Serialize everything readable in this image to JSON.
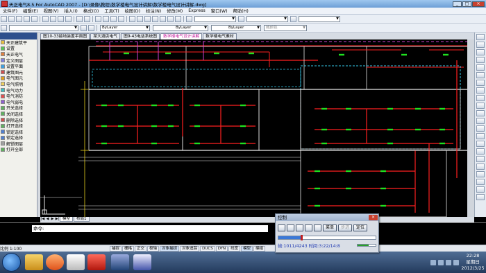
{
  "window": {
    "title": "天正电气8.5 For AutoCAD 2007 - [D:\\录像\\教程\\数学楼电气设计讲解\\数学楼电气设计讲解.dwg]",
    "buttons": [
      "_",
      "□",
      "×"
    ]
  },
  "menu": [
    "文件(F)",
    "编辑(E)",
    "视图(V)",
    "插入(I)",
    "格式(O)",
    "工具(T)",
    "绘图(D)",
    "标注(N)",
    "修改(M)",
    "Express",
    "窗口(W)",
    "帮助(H)"
  ],
  "toolbar2": {
    "layer_value": "ByLayer",
    "linetype_value": "ByLayer",
    "lineweight_value": "ByLayer",
    "plotstyle_value": "随颜色"
  },
  "palette": {
    "header": "",
    "items": [
      "天正建筑平",
      "设置",
      "天正电气",
      "定义图层",
      "设置平面",
      "建筑图元",
      "电气图元",
      "电气照明",
      "电气动力",
      "电气消防",
      "电气弱电",
      "开关选择",
      "关闭选择",
      "删除选择",
      "打开选择",
      "锁定选择",
      "锁定选择",
      "解锁图层",
      "打开全部"
    ]
  },
  "drawing_tabs": [
    {
      "label": "图10-33接地装置平面图",
      "active": false
    },
    {
      "label": "某大酒店电气",
      "active": false
    },
    {
      "label": "图9-43电话系统图",
      "active": false
    },
    {
      "label": "数学楼电气设计讲解",
      "active": true
    },
    {
      "label": "数学楼电气素材",
      "active": false
    }
  ],
  "model_tabs": [
    "模型",
    "布局1"
  ],
  "command": {
    "prompt": "命令:"
  },
  "status": {
    "scale": "比例 1:100",
    "buttons": [
      {
        "label": "捕捉",
        "on": false
      },
      {
        "label": "栅格",
        "on": false
      },
      {
        "label": "正交",
        "on": false
      },
      {
        "label": "极轴",
        "on": false
      },
      {
        "label": "对象捕捉",
        "on": true
      },
      {
        "label": "对象追踪",
        "on": false
      },
      {
        "label": "DUCS",
        "on": false
      },
      {
        "label": "DYN",
        "on": false
      },
      {
        "label": "线宽",
        "on": false
      },
      {
        "label": "模型",
        "on": true
      },
      {
        "label": "编组",
        "on": false
      }
    ]
  },
  "player": {
    "title": "控制",
    "close": "×",
    "menu_label": "菜单",
    "step_label": "步进",
    "locate_label": "定位",
    "frame_text": "帧:1011/4243 时间:3:22/14:8",
    "progress": 0.238,
    "volume": 0.6
  },
  "clock": {
    "time": "22:28",
    "weekday": "星期日",
    "date": "2012/3/25"
  },
  "colors": {
    "accent_title": "#6d9fd6",
    "canvas_bg": "#000000",
    "wire_red": "#ff2020",
    "wire_green": "#20e020",
    "wall_white": "#e8e8e8",
    "cyan_dashed": "#33c8e8",
    "player_text": "#1a35b0"
  }
}
